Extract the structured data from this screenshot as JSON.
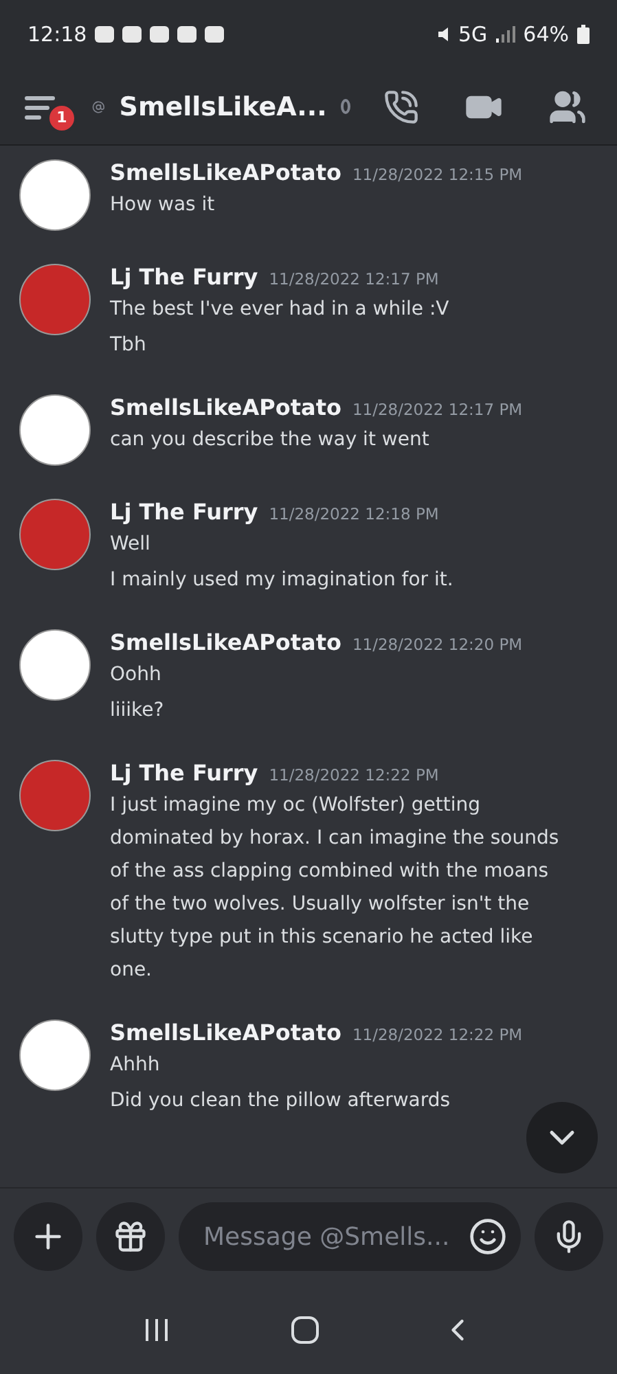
{
  "status_bar": {
    "time": "12:18",
    "network": "5G",
    "battery": "64%"
  },
  "header": {
    "unread_badge": "1",
    "title": "SmellsLikeA...",
    "online": false
  },
  "messages": [
    {
      "author": "SmellsLikeAPotato",
      "timestamp": "11/28/2022 12:15 PM",
      "color": "#ffffff",
      "lines": [
        "How was it"
      ]
    },
    {
      "author": "Lj The Furry",
      "timestamp": "11/28/2022 12:17 PM",
      "color": "#c62828",
      "lines": [
        "The best I've ever had in a while :V",
        "Tbh"
      ]
    },
    {
      "author": "SmellsLikeAPotato",
      "timestamp": "11/28/2022 12:17 PM",
      "color": "#ffffff",
      "lines": [
        "can you describe the way it went"
      ]
    },
    {
      "author": "Lj The Furry",
      "timestamp": "11/28/2022 12:18 PM",
      "color": "#c62828",
      "lines": [
        "Well",
        "I mainly used my imagination for it."
      ]
    },
    {
      "author": "SmellsLikeAPotato",
      "timestamp": "11/28/2022 12:20 PM",
      "color": "#ffffff",
      "lines": [
        "Oohh",
        "liiike?"
      ]
    },
    {
      "author": "Lj The Furry",
      "timestamp": "11/28/2022 12:22 PM",
      "color": "#c62828",
      "lines": [
        "I just imagine my oc (Wolfster) getting dominated by horax. I can imagine the sounds of the ass clapping combined with the moans of the two wolves. Usually wolfster isn't the slutty type put in this scenario he acted like one."
      ]
    },
    {
      "author": "SmellsLikeAPotato",
      "timestamp": "11/28/2022 12:22 PM",
      "color": "#ffffff",
      "lines": [
        "Ahhh",
        "Did you clean the pillow afterwards"
      ]
    }
  ],
  "composer": {
    "placeholder": "Message @Smells..."
  }
}
